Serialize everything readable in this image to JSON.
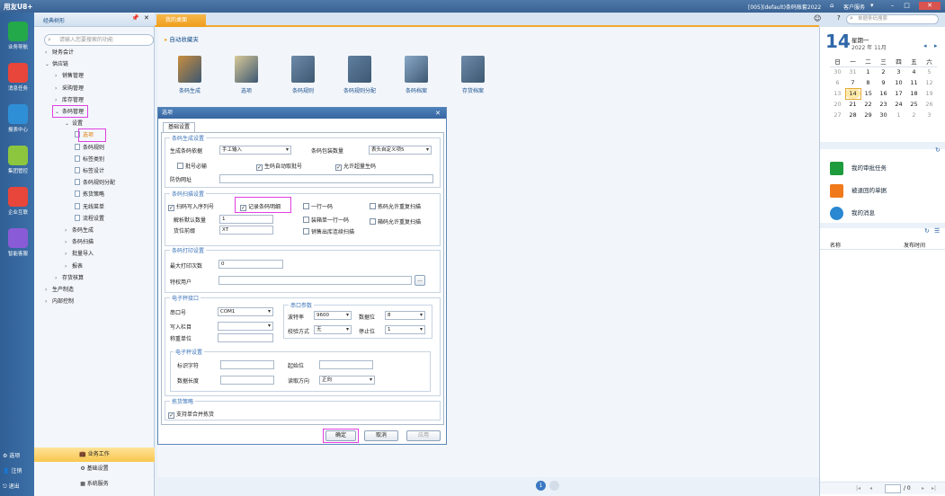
{
  "topbar": {
    "brand": "用友U8+",
    "account": "[005](default)条码账套2022",
    "service": "客户服务",
    "search_placeholder": "单据条码搜索"
  },
  "leftnav": [
    {
      "label": "业务导航",
      "color": "#23a84a"
    },
    {
      "label": "消息任务",
      "color": "#e8463a"
    },
    {
      "label": "报表中心",
      "color": "#2f8fd6"
    },
    {
      "label": "集团管控",
      "color": "#8cc63f"
    },
    {
      "label": "企业互联",
      "color": "#e8463a"
    },
    {
      "label": "智能客服",
      "color": "#8a5bd6"
    }
  ],
  "leftnav_bottom": {
    "options": "选项",
    "logout": "注销",
    "exit": "退出"
  },
  "panel": {
    "title": "经典树形",
    "search_placeholder": "请输入您要搜索的功能",
    "tree": [
      {
        "label": "财务会计",
        "indent": 0,
        "arrow": "›"
      },
      {
        "label": "供应链",
        "indent": 0,
        "arrow": "⌄"
      },
      {
        "label": "销售管理",
        "indent": 1,
        "arrow": "›"
      },
      {
        "label": "采购管理",
        "indent": 1,
        "arrow": "›"
      },
      {
        "label": "库存管理",
        "indent": 1,
        "arrow": "›"
      },
      {
        "label": "条码管理",
        "indent": 1,
        "arrow": "⌄",
        "highlight": true
      },
      {
        "label": "设置",
        "indent": 2,
        "arrow": "⌄"
      },
      {
        "label": "选项",
        "indent": 3,
        "doc": true,
        "highlight": true,
        "orange": true
      },
      {
        "label": "条码规则",
        "indent": 3,
        "doc": true
      },
      {
        "label": "标签类别",
        "indent": 3,
        "doc": true
      },
      {
        "label": "标签设计",
        "indent": 3,
        "doc": true
      },
      {
        "label": "条码规则分配",
        "indent": 3,
        "doc": true
      },
      {
        "label": "拣货策略",
        "indent": 3,
        "doc": true
      },
      {
        "label": "无线菜单",
        "indent": 3,
        "doc": true
      },
      {
        "label": "流程设置",
        "indent": 3,
        "doc": true
      },
      {
        "label": "条码生成",
        "indent": 2,
        "arrow": "›"
      },
      {
        "label": "条码扫描",
        "indent": 2,
        "arrow": "›"
      },
      {
        "label": "批量导入",
        "indent": 2,
        "arrow": "›"
      },
      {
        "label": "报表",
        "indent": 2,
        "arrow": "›"
      },
      {
        "label": "存货核算",
        "indent": 1,
        "arrow": "›"
      },
      {
        "label": "生产制造",
        "indent": 0,
        "arrow": "›"
      },
      {
        "label": "内部控制",
        "indent": 0,
        "arrow": "›"
      }
    ],
    "footer": [
      "业务工作",
      "基础设置",
      "系统服务"
    ]
  },
  "tab": "我的桌面",
  "breadcrumb": "自动收藏夹",
  "tools": [
    {
      "label": "条码生成",
      "color": "#c88d3e"
    },
    {
      "label": "选项",
      "color": "#d8c998"
    },
    {
      "label": "条码规则",
      "color": "#6d8aa8"
    },
    {
      "label": "条码规则分配",
      "color": "#5f7e9f"
    },
    {
      "label": "条码档案",
      "color": "#8aa9c8"
    },
    {
      "label": "存货档案",
      "color": "#6d8aa8"
    }
  ],
  "dialog": {
    "title": "选项",
    "tab": "基础设置",
    "gen": {
      "legend": "条码生成设置",
      "basis_label": "生成条码依据",
      "basis_value": "手工输入",
      "pack_label": "条码包装数量",
      "pack_value": "表头自定义项5",
      "batch_required": "批号必输",
      "auto_batch": "生码自动取批号",
      "allow_over": "允许超量生码",
      "anti_fake": "防伪网址"
    },
    "scan": {
      "legend": "条码扫描设置",
      "scan_serial": "扫码写入序列号",
      "record_detail": "记录条码明细",
      "one_item": "一行一码",
      "allow_rescan": "拣码允许重复扫描",
      "default_qty_label": "解析默认数量",
      "default_qty_value": "1",
      "pos_prefix_label": "货位前缀",
      "pos_prefix_value": "XT",
      "box_one_line": "装箱单一行一码",
      "box_allow_rescan": "箱码允许重复扫描",
      "sales_continuous": "销售出库连续扫描"
    },
    "print": {
      "legend": "条码打印设置",
      "max_times_label": "最大打印次数",
      "max_times_value": "0",
      "priv_user_label": "特权用户",
      "more": "..."
    },
    "scale": {
      "legend": "电子秤接口",
      "port_label": "串口号",
      "port_value": "COM1",
      "write_col_label": "写入栏目",
      "unit_label": "称重单位",
      "serial_legend": "串口参数",
      "baud_label": "波特率",
      "baud_value": "9600",
      "databits_label": "数据位",
      "databits_value": "8",
      "parity_label": "校验方式",
      "parity_value": "无",
      "stopbits_label": "停止位",
      "stopbits_value": "1",
      "sub_legend": "电子秤设置",
      "id_char": "标识字符",
      "start_pos": "起始位",
      "data_len": "数据长度",
      "read_dir": "读取方向",
      "read_dir_value": "正向"
    },
    "pick": {
      "legend": "拣货策略",
      "merge": "支持单合并拣货"
    },
    "buttons": {
      "ok": "确定",
      "cancel": "取消",
      "apply": "应用"
    }
  },
  "pager": "1",
  "calendar": {
    "day": "14",
    "weekday": "星期一",
    "month": "2022 年 11月",
    "headers": [
      "日",
      "一",
      "二",
      "三",
      "四",
      "五",
      "六"
    ],
    "weeks": [
      [
        "30",
        "31",
        "1",
        "2",
        "3",
        "4",
        "5"
      ],
      [
        "6",
        "7",
        "8",
        "9",
        "10",
        "11",
        "12"
      ],
      [
        "13",
        "14",
        "15",
        "16",
        "17",
        "18",
        "19"
      ],
      [
        "20",
        "21",
        "22",
        "23",
        "24",
        "25",
        "26"
      ],
      [
        "27",
        "28",
        "29",
        "30",
        "1",
        "2",
        "3"
      ]
    ]
  },
  "tasks": [
    {
      "label": "我的审批任务",
      "color": "#1e9b3c"
    },
    {
      "label": "被退回的单据",
      "color": "#f07a1a"
    },
    {
      "label": "我的消息",
      "color": "#2a87d2"
    }
  ],
  "msg_table": {
    "col_name": "名称",
    "col_time": "发布时间"
  },
  "right_pager": {
    "page": "",
    "total": "/ 0"
  }
}
